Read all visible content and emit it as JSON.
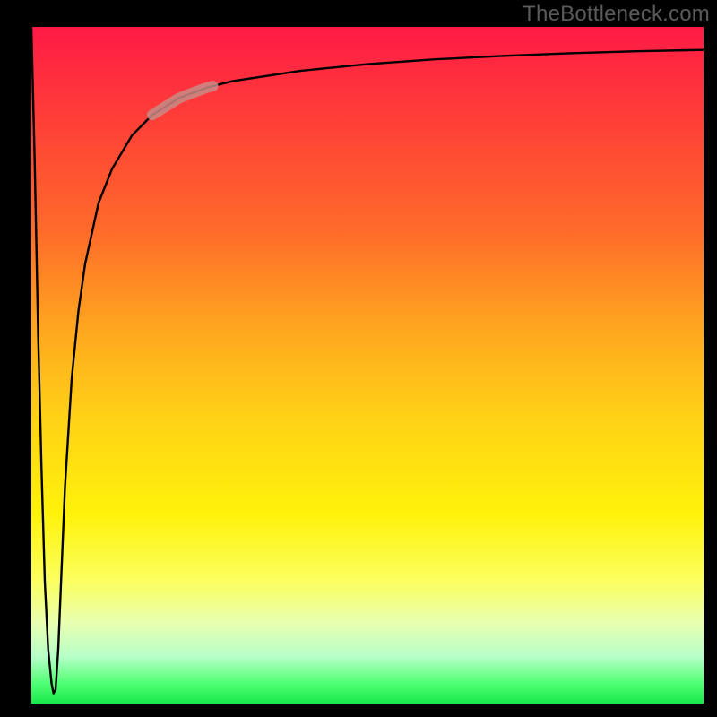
{
  "watermark": "TheBottleneck.com",
  "chart_data": {
    "type": "line",
    "title": "",
    "xlabel": "",
    "ylabel": "",
    "xlim": [
      0,
      100
    ],
    "ylim": [
      0,
      100
    ],
    "grid": false,
    "legend": false,
    "background_gradient": {
      "stops": [
        {
          "pos": 0.0,
          "color": "#ff1a45"
        },
        {
          "pos": 0.12,
          "color": "#ff3a3a"
        },
        {
          "pos": 0.3,
          "color": "#ff6a2a"
        },
        {
          "pos": 0.45,
          "color": "#ffa81e"
        },
        {
          "pos": 0.58,
          "color": "#ffd216"
        },
        {
          "pos": 0.72,
          "color": "#fff20a"
        },
        {
          "pos": 0.82,
          "color": "#fbff60"
        },
        {
          "pos": 0.88,
          "color": "#e9ffb0"
        },
        {
          "pos": 0.93,
          "color": "#b8ffc8"
        },
        {
          "pos": 0.97,
          "color": "#50ff75"
        },
        {
          "pos": 1.0,
          "color": "#18e84a"
        }
      ]
    },
    "series": [
      {
        "name": "bottleneck-curve",
        "stroke": "#000000",
        "x": [
          0.0,
          0.5,
          1.0,
          1.5,
          2.0,
          2.5,
          3.0,
          3.3,
          3.6,
          4.0,
          4.5,
          5.0,
          6.0,
          7.0,
          8.0,
          10.0,
          12.0,
          15.0,
          18.0,
          22.0,
          26.0,
          30.0,
          40.0,
          50.0,
          60.0,
          70.0,
          80.0,
          90.0,
          100.0
        ],
        "y": [
          100.0,
          80.0,
          55.0,
          35.0,
          18.0,
          8.0,
          3.0,
          1.5,
          2.0,
          8.0,
          20.0,
          32.0,
          48.0,
          58.0,
          65.0,
          74.0,
          79.0,
          84.0,
          87.0,
          89.5,
          91.0,
          92.0,
          93.5,
          94.5,
          95.2,
          95.7,
          96.1,
          96.4,
          96.6
        ]
      }
    ],
    "highlight_segment": {
      "name": "rose-segment",
      "stroke": "#c98b86",
      "x_range": [
        18.0,
        27.0
      ],
      "y_range": [
        87.0,
        91.0
      ]
    }
  }
}
